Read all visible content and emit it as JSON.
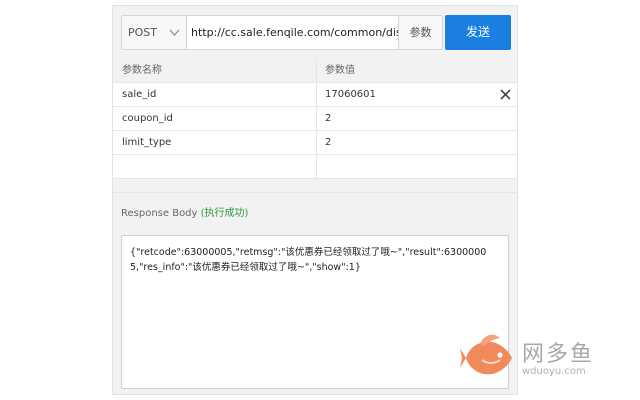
{
  "request": {
    "method": "POST",
    "url": "http://cc.sale.fenqile.com/common/discoun",
    "params_label": "参数",
    "send_label": "发送"
  },
  "params_table": {
    "headers": [
      "参数名称",
      "参数值"
    ],
    "rows": [
      {
        "name": "sale_id",
        "value": "17060601"
      },
      {
        "name": "coupon_id",
        "value": "2"
      },
      {
        "name": "limit_type",
        "value": "2"
      },
      {
        "name": "",
        "value": ""
      }
    ]
  },
  "response": {
    "title": "Response Body",
    "status": "(执行成功)",
    "body": "{\"retcode\":63000005,\"retmsg\":\"该优惠券已经领取过了哦~\",\"result\":63000005,\"res_info\":\"该优惠券已经领取过了哦~\",\"show\":1}"
  },
  "watermark": {
    "name_cn": "网多鱼",
    "domain": "wduoyu.com",
    "accent": "#f08a5d"
  },
  "colors": {
    "send_button": "#1a7fe0",
    "success": "#2e9a3e"
  }
}
